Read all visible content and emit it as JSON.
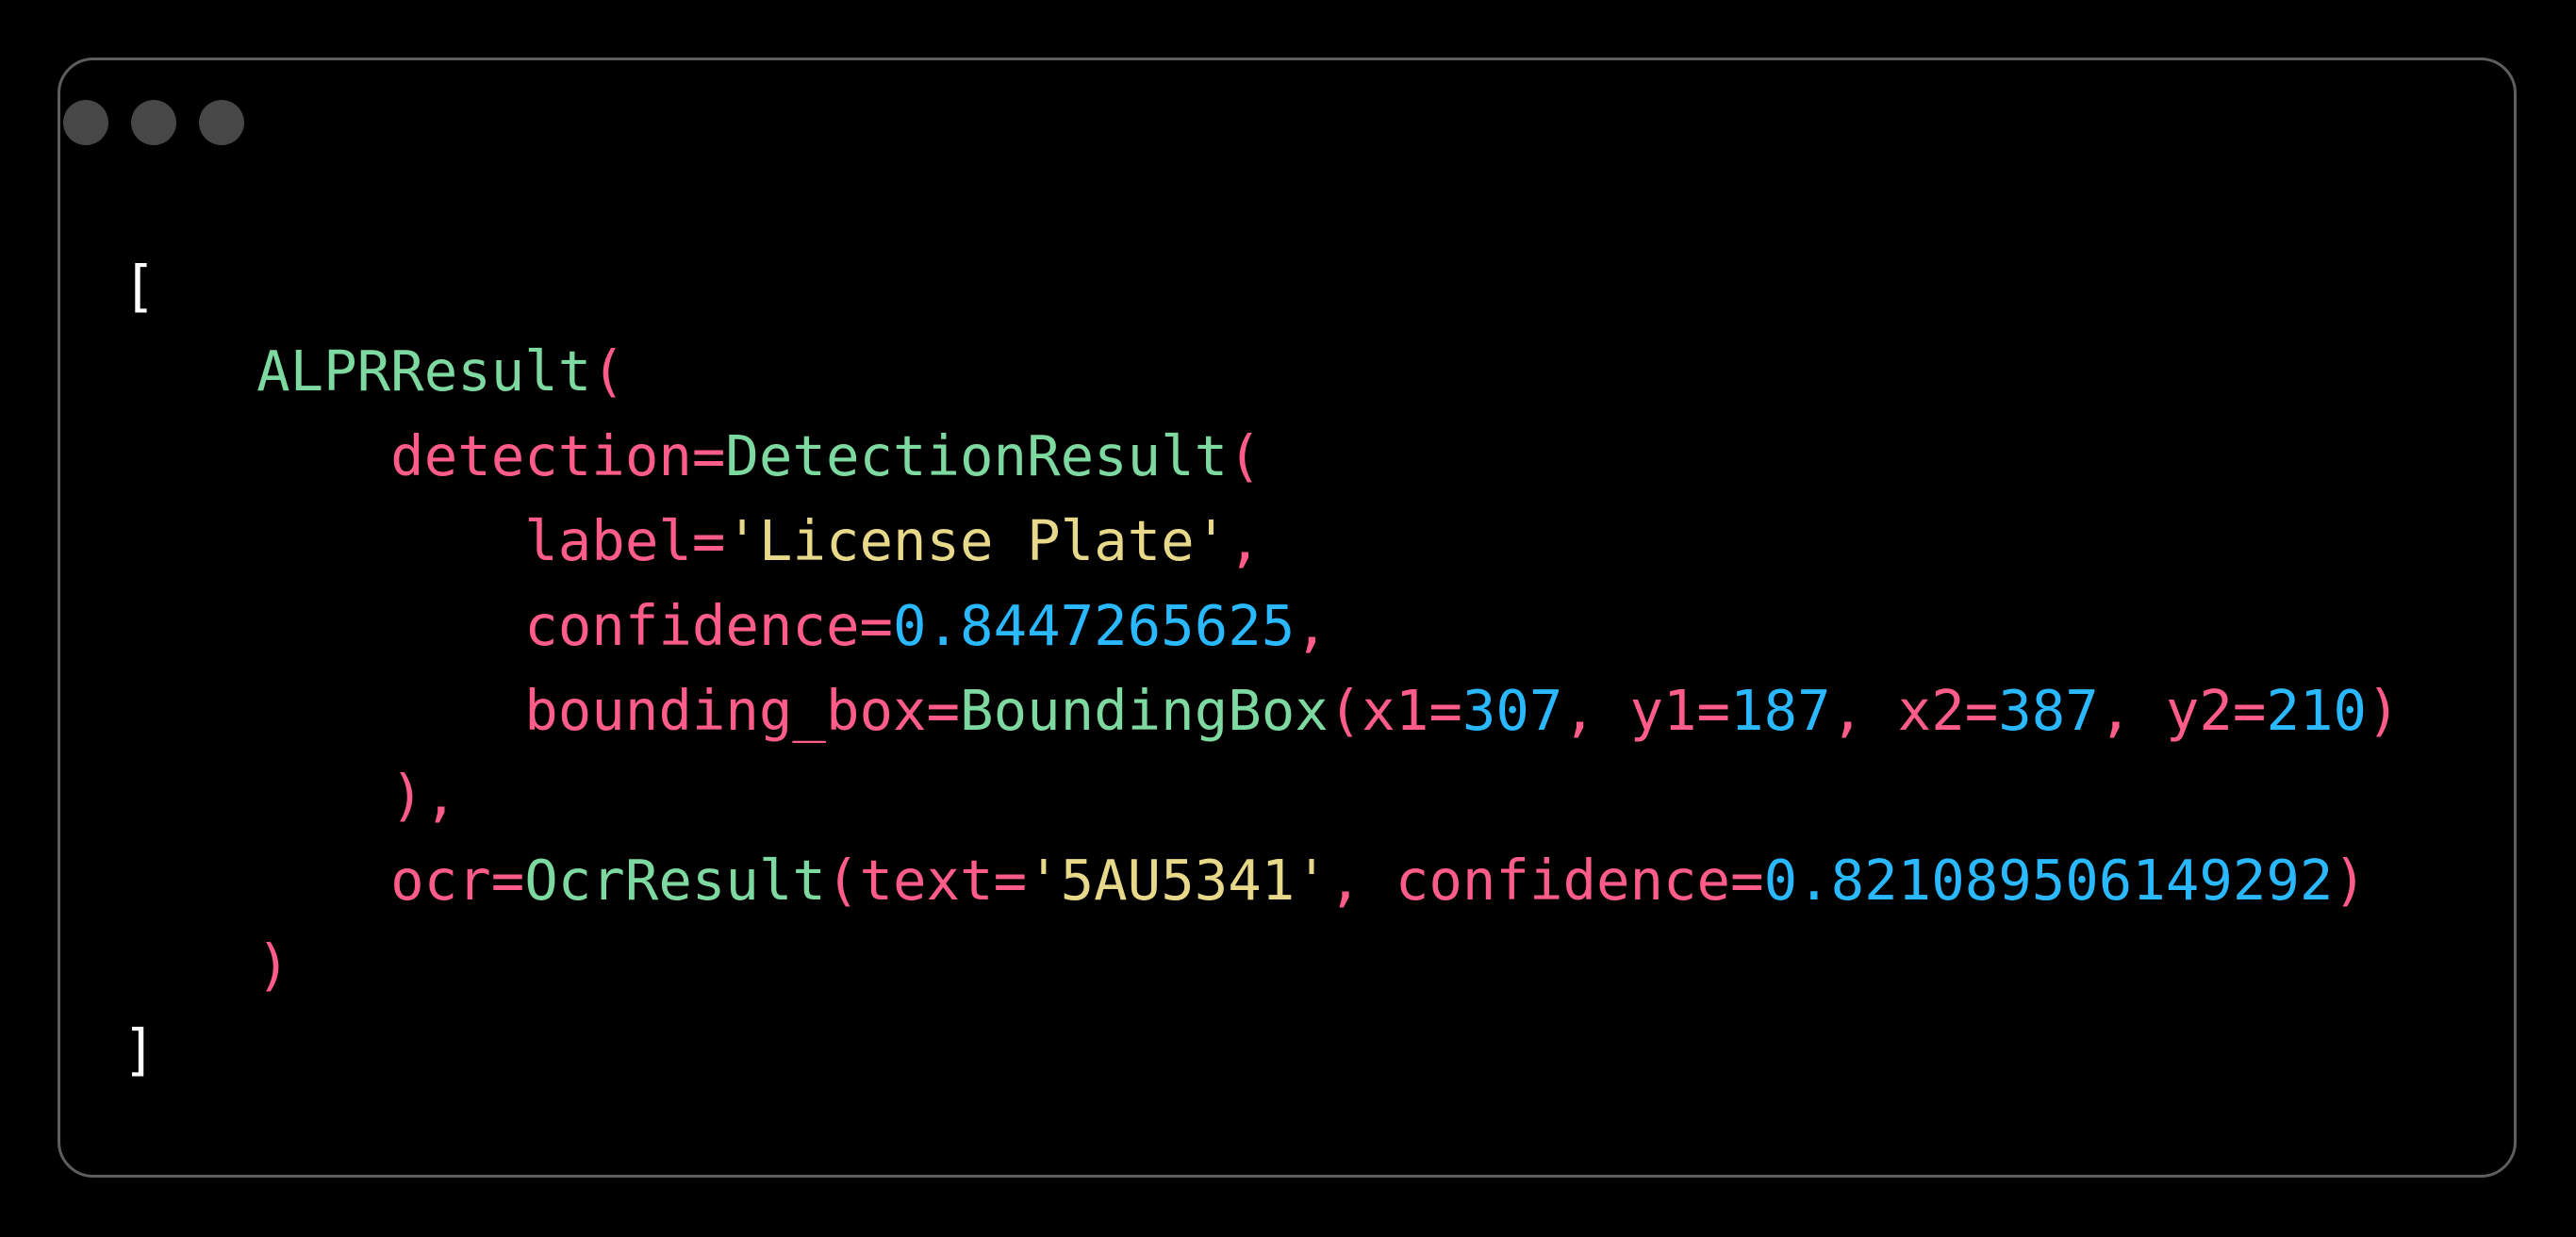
{
  "colors": {
    "background": "#000000",
    "window_border": "#5e5e5e",
    "window_dot": "#474747",
    "default": "#ffffff",
    "keyword": "#ff5c8a",
    "class": "#7ed9a0",
    "string": "#e8d98a",
    "number": "#2ab8ff"
  },
  "window_controls": {
    "icons": [
      "window-dot-icon",
      "window-dot-icon",
      "window-dot-icon"
    ]
  },
  "code_lines": [
    {
      "indent": 0,
      "tokens": [
        {
          "text": "[",
          "type": "default"
        }
      ]
    },
    {
      "indent": 1,
      "tokens": [
        {
          "text": "ALPRResult",
          "type": "class"
        },
        {
          "text": "(",
          "type": "keyword"
        }
      ]
    },
    {
      "indent": 2,
      "tokens": [
        {
          "text": "detection=",
          "type": "keyword"
        },
        {
          "text": "DetectionResult",
          "type": "class"
        },
        {
          "text": "(",
          "type": "keyword"
        }
      ]
    },
    {
      "indent": 3,
      "tokens": [
        {
          "text": "label=",
          "type": "keyword"
        },
        {
          "text": "'License Plate'",
          "type": "string"
        },
        {
          "text": ",",
          "type": "keyword"
        }
      ]
    },
    {
      "indent": 3,
      "tokens": [
        {
          "text": "confidence=",
          "type": "keyword"
        },
        {
          "text": "0.8447265625",
          "type": "number"
        },
        {
          "text": ",",
          "type": "keyword"
        }
      ]
    },
    {
      "indent": 3,
      "tokens": [
        {
          "text": "bounding_box=",
          "type": "keyword"
        },
        {
          "text": "BoundingBox",
          "type": "class"
        },
        {
          "text": "(x1=",
          "type": "keyword"
        },
        {
          "text": "307",
          "type": "number"
        },
        {
          "text": ", y1=",
          "type": "keyword"
        },
        {
          "text": "187",
          "type": "number"
        },
        {
          "text": ", x2=",
          "type": "keyword"
        },
        {
          "text": "387",
          "type": "number"
        },
        {
          "text": ", y2=",
          "type": "keyword"
        },
        {
          "text": "210",
          "type": "number"
        },
        {
          "text": ")",
          "type": "keyword"
        }
      ]
    },
    {
      "indent": 2,
      "tokens": [
        {
          "text": "),",
          "type": "keyword"
        }
      ]
    },
    {
      "indent": 2,
      "tokens": [
        {
          "text": "ocr=",
          "type": "keyword"
        },
        {
          "text": "OcrResult",
          "type": "class"
        },
        {
          "text": "(text=",
          "type": "keyword"
        },
        {
          "text": "'5AU5341'",
          "type": "string"
        },
        {
          "text": ", confidence=",
          "type": "keyword"
        },
        {
          "text": "0.821089506149292",
          "type": "number"
        },
        {
          "text": ")",
          "type": "keyword"
        }
      ]
    },
    {
      "indent": 1,
      "tokens": [
        {
          "text": ")",
          "type": "keyword"
        }
      ]
    },
    {
      "indent": 0,
      "tokens": [
        {
          "text": "]",
          "type": "default"
        }
      ]
    }
  ]
}
